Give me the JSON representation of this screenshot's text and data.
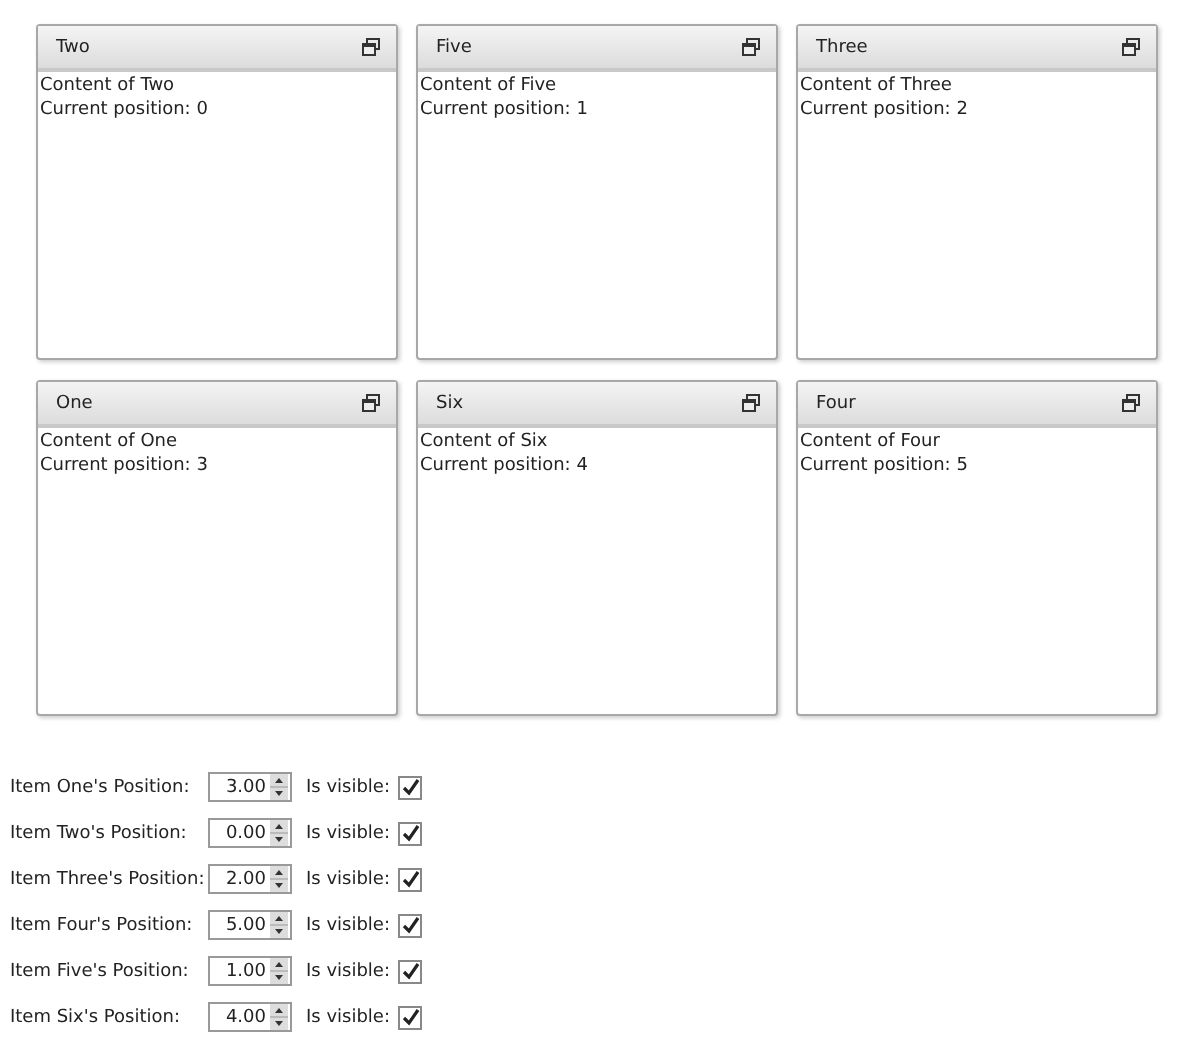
{
  "panels": [
    {
      "title": "Two",
      "lines": [
        "Content of Two",
        "Current position: 0"
      ]
    },
    {
      "title": "Five",
      "lines": [
        "Content of Five",
        "Current position: 1"
      ]
    },
    {
      "title": "Three",
      "lines": [
        "Content of Three",
        "Current position: 2"
      ]
    },
    {
      "title": "One",
      "lines": [
        "Content of One",
        "Current position: 3"
      ]
    },
    {
      "title": "Six",
      "lines": [
        "Content of Six",
        "Current position: 4"
      ]
    },
    {
      "title": "Four",
      "lines": [
        "Content of Four",
        "Current position: 5"
      ]
    }
  ],
  "settings": [
    {
      "label": "Item One's Position:",
      "value": "3.00",
      "visible_label": "Is visible:",
      "checked": true
    },
    {
      "label": "Item Two's Position:",
      "value": "0.00",
      "visible_label": "Is visible:",
      "checked": true
    },
    {
      "label": "Item Three's Position:",
      "value": "2.00",
      "visible_label": "Is visible:",
      "checked": true
    },
    {
      "label": "Item Four's Position:",
      "value": "5.00",
      "visible_label": "Is visible:",
      "checked": true
    },
    {
      "label": "Item Five's Position:",
      "value": "1.00",
      "visible_label": "Is visible:",
      "checked": true
    },
    {
      "label": "Item Six's Position:",
      "value": "4.00",
      "visible_label": "Is visible:",
      "checked": true
    }
  ]
}
